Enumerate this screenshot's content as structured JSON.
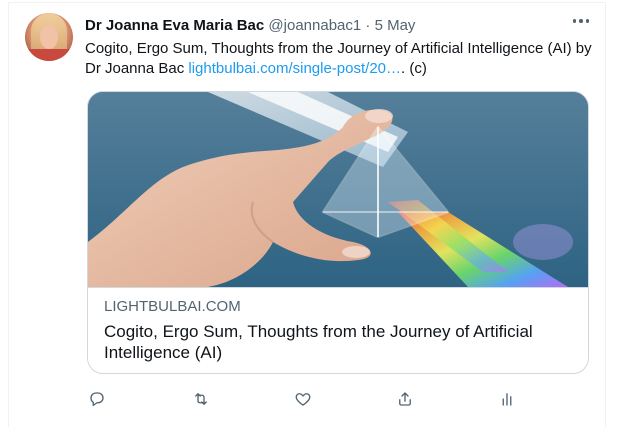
{
  "tweet": {
    "author_name": "Dr Joanna Eva Maria Bac",
    "handle": "@joannabac1",
    "separator": "·",
    "date": "5 May",
    "text_line": "Cogito, Ergo Sum, Thoughts from the Journey of Artificial Intelligence (AI) by Dr Joanna Bac ",
    "link_text": "lightbulbai.com/single-post/20…",
    "text_suffix": ". (c)"
  },
  "card": {
    "domain": "LIGHTBULBAI.COM",
    "title": "Cogito, Ergo Sum, Thoughts from the Journey of Artificial Intelligence (AI)"
  },
  "icons": {
    "more": "more-horizontal-icon",
    "reply": "reply-icon",
    "retweet": "retweet-icon",
    "like": "heart-icon",
    "share": "share-icon",
    "analytics": "analytics-icon"
  },
  "colors": {
    "link": "#1d9bf0",
    "secondary_text": "#536471",
    "border": "#cfd9de"
  }
}
